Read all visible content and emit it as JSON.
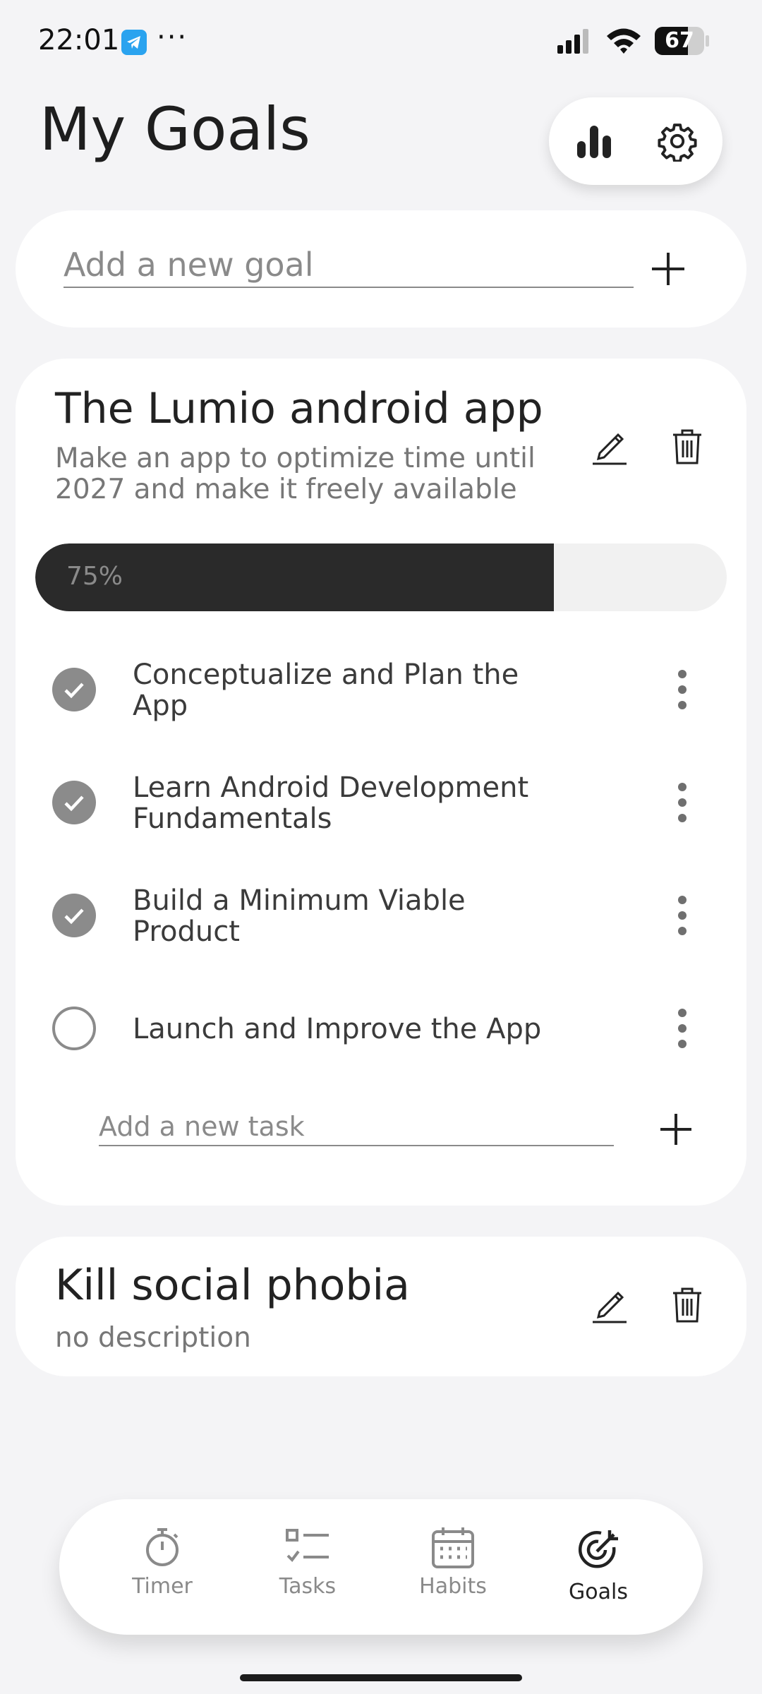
{
  "status_bar": {
    "time": "22:01",
    "extra": "···",
    "battery": "67",
    "battery_level": 0.67,
    "icons": [
      "telegram-icon",
      "signal-icon",
      "wifi-icon",
      "battery-icon"
    ]
  },
  "header": {
    "title": "My Goals",
    "icons": [
      "bar-chart-icon",
      "gear-icon"
    ]
  },
  "add_goal": {
    "placeholder": "Add a new goal",
    "icon": "plus-icon"
  },
  "goals": [
    {
      "title": "The Lumio android app",
      "description": "Make an app to optimize time until 2027 and make it freely available",
      "progress_label": "75%",
      "progress": 0.75,
      "tasks": [
        {
          "label": "Conceptualize and Plan the App",
          "done": true
        },
        {
          "label": "Learn Android Development Fundamentals",
          "done": true
        },
        {
          "label": "Build a Minimum Viable Product",
          "done": true
        },
        {
          "label": "Launch and Improve the App",
          "done": false
        }
      ],
      "add_task_placeholder": "Add a new task"
    },
    {
      "title": "Kill social phobia",
      "description": "no description"
    }
  ],
  "nav": {
    "items": [
      {
        "label": "Timer",
        "icon": "stopwatch-icon",
        "active": false
      },
      {
        "label": "Tasks",
        "icon": "checklist-icon",
        "active": false
      },
      {
        "label": "Habits",
        "icon": "calendar-icon",
        "active": false
      },
      {
        "label": "Goals",
        "icon": "target-icon",
        "active": true
      }
    ]
  },
  "colors": {
    "background": "#f4f4f6",
    "card": "#ffffff",
    "progress_fill": "#2a2a2a",
    "check_done": "#8b8b8b",
    "muted_text": "#8a8a8a"
  }
}
